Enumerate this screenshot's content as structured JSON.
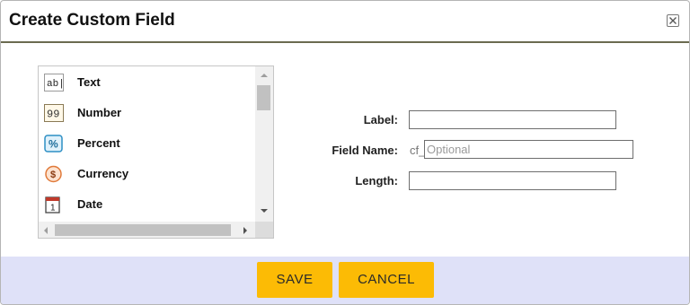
{
  "dialog": {
    "title": "Create Custom Field"
  },
  "field_types": [
    {
      "label": "Text",
      "icon": "text-type-icon",
      "glyph": "ab|"
    },
    {
      "label": "Number",
      "icon": "number-type-icon",
      "glyph": "99"
    },
    {
      "label": "Percent",
      "icon": "percent-type-icon",
      "glyph": "%"
    },
    {
      "label": "Currency",
      "icon": "currency-type-icon",
      "glyph": "$"
    },
    {
      "label": "Date",
      "icon": "date-type-icon",
      "glyph": "1"
    }
  ],
  "form": {
    "label_label": "Label:",
    "label_value": "",
    "field_name_label": "Field Name:",
    "field_name_prefix": "cf_",
    "field_name_placeholder": "Optional",
    "field_name_value": "",
    "length_label": "Length:",
    "length_value": ""
  },
  "footer": {
    "save_label": "SAVE",
    "cancel_label": "CANCEL"
  },
  "colors": {
    "button_bg": "#fcbb05",
    "footer_bg": "#dfe1f8",
    "header_rule": "#6b6b50"
  }
}
